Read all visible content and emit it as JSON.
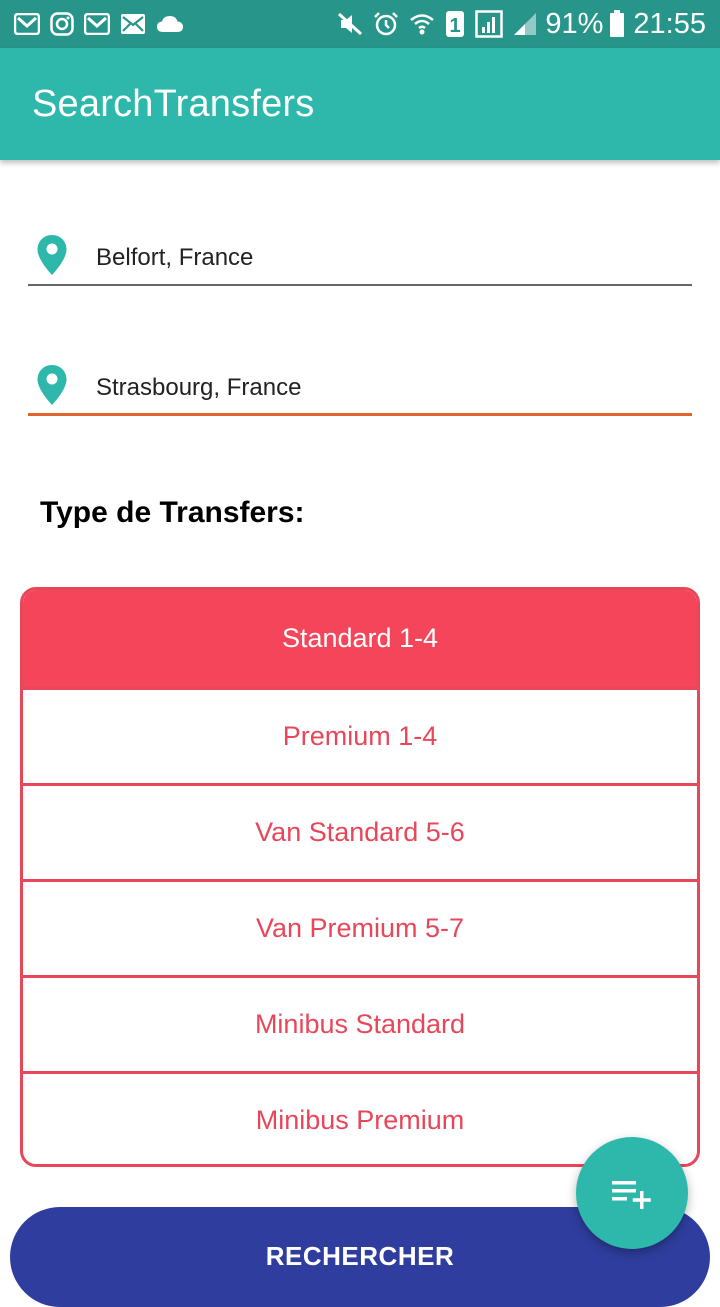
{
  "status_bar": {
    "icons_left": [
      "gmail-icon",
      "instagram-icon",
      "gmail-icon",
      "mail-icon",
      "cloud-icon"
    ],
    "icons_right": [
      "mute-icon",
      "alarm-icon",
      "wifi-icon",
      "sim-1-icon",
      "signal-icon"
    ],
    "battery": "91%",
    "time": "21:55"
  },
  "app_bar": {
    "title": "SearchTransfers"
  },
  "form": {
    "origin": {
      "value": "Belfort, France",
      "icon": "location-pin-icon"
    },
    "destination": {
      "value": "Strasbourg, France",
      "icon": "location-pin-icon"
    }
  },
  "transfer_types": {
    "title": "Type de Transfers:",
    "items": [
      {
        "label": "Standard 1-4",
        "selected": true
      },
      {
        "label": "Premium 1-4",
        "selected": false
      },
      {
        "label": "Van Standard 5-6",
        "selected": false
      },
      {
        "label": "Van Premium 5-7",
        "selected": false
      },
      {
        "label": "Minibus Standard",
        "selected": false
      },
      {
        "label": "Minibus Premium",
        "selected": false
      }
    ],
    "accent_color": "#e8475a"
  },
  "search_button": {
    "label": "RECHERCHER"
  },
  "fab": {
    "icon": "playlist-add-icon"
  },
  "colors": {
    "primary": "#2eb8ab",
    "primary_dark": "#27958a",
    "button": "#2f3e9e",
    "focus_line": "#e0652c"
  }
}
